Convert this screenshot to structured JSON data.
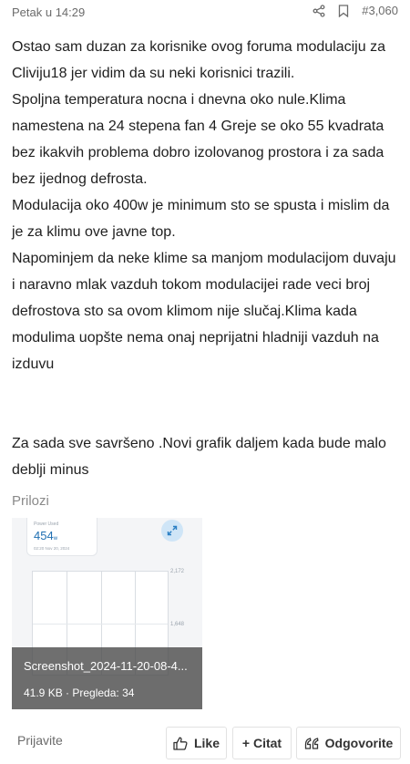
{
  "meta": {
    "date": "Petak u 14:29",
    "post_number": "#3,060",
    "icons": [
      "share-icon",
      "bookmark-icon"
    ]
  },
  "post": {
    "paragraphs": [
      "Ostao sam duzan za korisnike ovog foruma modulaciju za Cliviju18 jer vidim da su neki korisnici trazili.",
      "Spoljna temperatura nocna i dnevna oko nule.Klima namestena na 24 stepena fan 4 Greje se oko 55 kvadrata bez ikakvih problema dobro izolovanog prostora i za sada bez ijednog defrosta.",
      "Modulacija oko 400w je minimum sto se spusta i mislim da je za klimu ove javne top.",
      "Napominjem da neke klime sa manjom modulacijom duvaju i naravno mlak vazduh tokom modulacijei rade veci broj defrostova sto sa ovom klimom nije slučaj.Klima kada modulima uopšte nema onaj neprijatni hladniji vazduh na izduvu",
      "Za sada sve savršeno .Novi grafik daljem kada bude malo deblji minus"
    ]
  },
  "attachments": {
    "label": "Prilozi",
    "thumbnail": {
      "card_label": "Power Used",
      "card_value": "454",
      "card_unit": "w",
      "card_time": "02:20 Nov 20, 2024",
      "y_tick_top": "2,172",
      "y_tick_mid": "1,648",
      "file_name": "Screenshot_2024-11-20-08-4...",
      "file_info": "41.9 KB · Pregleda: 34"
    }
  },
  "footer": {
    "login": "Prijavite",
    "like_label": "Like",
    "quote_label": "+ Citat",
    "reply_label": "Odgovorite"
  },
  "colors": {
    "accent": "#1f6fb2",
    "muted": "#6b6b6b"
  }
}
